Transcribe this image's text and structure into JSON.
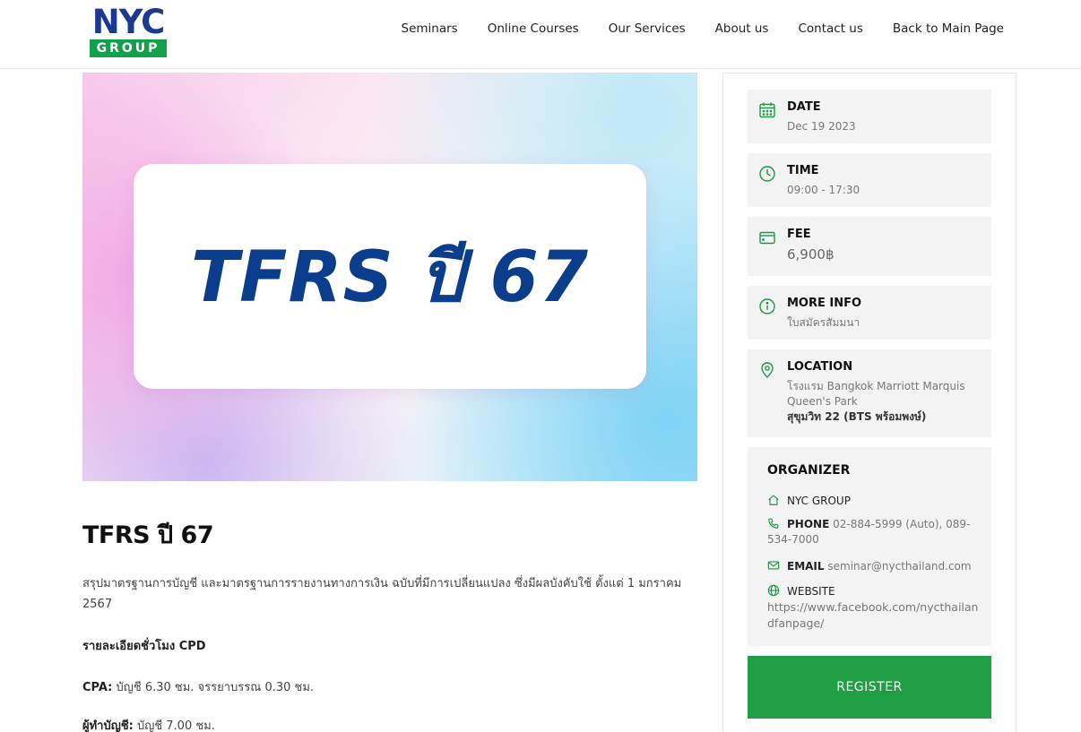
{
  "logo": {
    "top": "NYC",
    "bottom": "GROUP"
  },
  "nav": [
    "Seminars",
    "Online Courses",
    "Our Services",
    "About us",
    "Contact us",
    "Back to Main Page"
  ],
  "hero": {
    "title": "TFRS ปี 67"
  },
  "main": {
    "title": "TFRS ปี 67",
    "description": "สรุปมาตรฐานการบัญชี และมาตรฐานการรายงานทางการเงิน ฉบับที่มีการเปลี่ยนแปลง ซึ่งมีผลบังคับใช้ ตั้งแต่ 1 มกราคม 2567",
    "cpd_heading": "รายละเอียดชั่วโมง CPD",
    "cpa_label": "CPA:",
    "cpa_value": "บัญชี 6.30 ชม. จรรยาบรรณ 0.30 ชม.",
    "acc_label": "ผู้ทำบัญชี:",
    "acc_value": "บัญชี 7.00 ชม."
  },
  "sidebar": {
    "date": {
      "label": "DATE",
      "value": "Dec 19 2023"
    },
    "time": {
      "label": "TIME",
      "value": "09:00 - 17:30"
    },
    "fee": {
      "label": "FEE",
      "value": "6,900฿"
    },
    "more_info": {
      "label": "MORE INFO",
      "value": "ใบสมัครสัมมนา"
    },
    "location": {
      "label": "LOCATION",
      "line1": "โรงแรม Bangkok Marriott Marquis Queen's Park",
      "line2": "สุขุมวิท 22 (BTS พร้อมพงษ์)"
    },
    "organizer": {
      "title": "ORGANIZER",
      "name": "NYC GROUP",
      "phone_label": "PHONE",
      "phone_value": "02-884-5999 (Auto), 089-534-7000",
      "email_label": "EMAIL",
      "email_value": "seminar@nycthailand.com",
      "website_label": "WEBSITE",
      "website_value": "https://www.facebook.com/nycthailandfanpage/"
    },
    "register_label": "REGISTER"
  },
  "colors": {
    "brand_green": "#1f9e44",
    "brand_blue": "#1b3a8f",
    "hero_text": "#0a3d8c"
  }
}
